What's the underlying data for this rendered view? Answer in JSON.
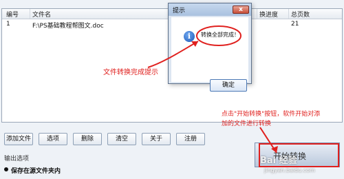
{
  "table": {
    "headers": [
      "编号",
      "文件名",
      "换进度",
      "总页数"
    ],
    "row": {
      "index": "1",
      "filename": "F:\\PS基础教程帮图文.doc",
      "pages": "21"
    }
  },
  "buttons": [
    "添加文件",
    "选项",
    "删除",
    "清空",
    "关于",
    "注册"
  ],
  "output": {
    "label": "输出选项",
    "radio_label": "保存在源文件夹内"
  },
  "dialog": {
    "title": "提示",
    "message": "转换全部完成！",
    "ok": "确定",
    "close_glyph": "x"
  },
  "annotations": {
    "done": "文件转换完成提示",
    "start_line1": "点击\"开始转换\"按钮，软件开始对添",
    "start_line2": "加的文件进行转换"
  },
  "start_button": {
    "label": "开始转换"
  },
  "watermark": {
    "brand": "Bai 经验",
    "url": "jingyan.baidu.com"
  },
  "colors": {
    "accent_red": "#e0201e",
    "info_blue": "#1b58b8"
  }
}
